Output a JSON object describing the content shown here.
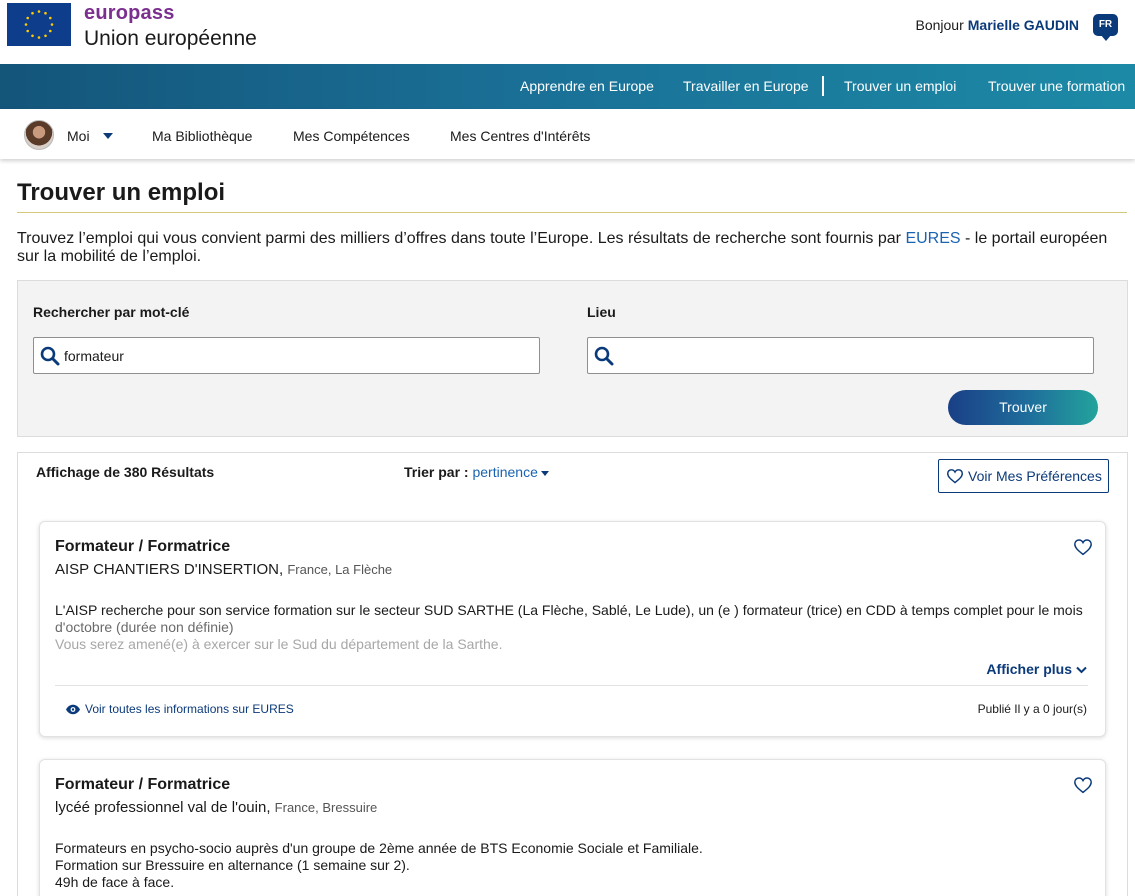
{
  "header": {
    "brand": "europass",
    "subtitle": "Union européenne",
    "greeting": "Bonjour",
    "user_name": "Marielle GAUDIN",
    "language": "FR"
  },
  "main_nav": {
    "items": [
      "Apprendre en Europe",
      "Travailler en Europe",
      "Trouver un emploi",
      "Trouver une formation"
    ]
  },
  "sub_nav": {
    "me": "Moi",
    "items": [
      "Ma Bibliothèque",
      "Mes Compétences",
      "Mes Centres d'Intérêts"
    ]
  },
  "page": {
    "title": "Trouver un emploi",
    "intro_before": "Trouvez l’emploi qui vous convient parmi des milliers d’offres dans toute l’Europe. Les résultats de recherche sont fournis par ",
    "intro_link": "EURES",
    "intro_after": " - le portail européen sur la mobilité de l’emploi."
  },
  "search": {
    "keyword_label": "Rechercher par mot-clé",
    "keyword_value": "formateur",
    "location_label": "Lieu",
    "location_value": "",
    "button": "Trouver"
  },
  "results": {
    "count_label": "Affichage de 380 Résultats",
    "sort_label": "Trier par :",
    "sort_value": "pertinence",
    "preferences_button": "Voir Mes Préférences",
    "jobs": [
      {
        "title": "Formateur / Formatrice",
        "company": "AISP CHANTIERS D'INSERTION,",
        "country": "France",
        "city": "La Flèche",
        "desc_line1": "L'AISP recherche pour son service formation sur le secteur SUD SARTHE (La Flèche, Sablé, Le Lude), un (e ) formateur (trice) en CDD à temps complet pour le mois",
        "desc_line2": "d'octobre (durée non définie)",
        "desc_line3": "Vous serez amené(e) à exercer sur le Sud du département de la Sarthe.",
        "show_more": "Afficher plus",
        "eures_link": "Voir toutes les informations sur EURES",
        "published": "Publié Il y a 0 jour(s)"
      },
      {
        "title": "Formateur / Formatrice",
        "company": "lycéé professionnel val de l'ouin,",
        "country": "France",
        "city": "Bressuire",
        "desc_line1": "Formateurs en psycho-socio auprès d'un groupe de 2ème année de BTS Economie Sociale et Familiale.",
        "desc_line2": "Formation sur Bressuire en alternance (1 semaine sur 2).",
        "desc_line3": "49h de face à face."
      }
    ]
  },
  "colors": {
    "brand_purple": "#7b2f8e",
    "navy": "#0b3a7a",
    "link_blue": "#1a63b0",
    "eu_blue": "#0e3d8c",
    "eu_gold": "#ffcc00"
  }
}
